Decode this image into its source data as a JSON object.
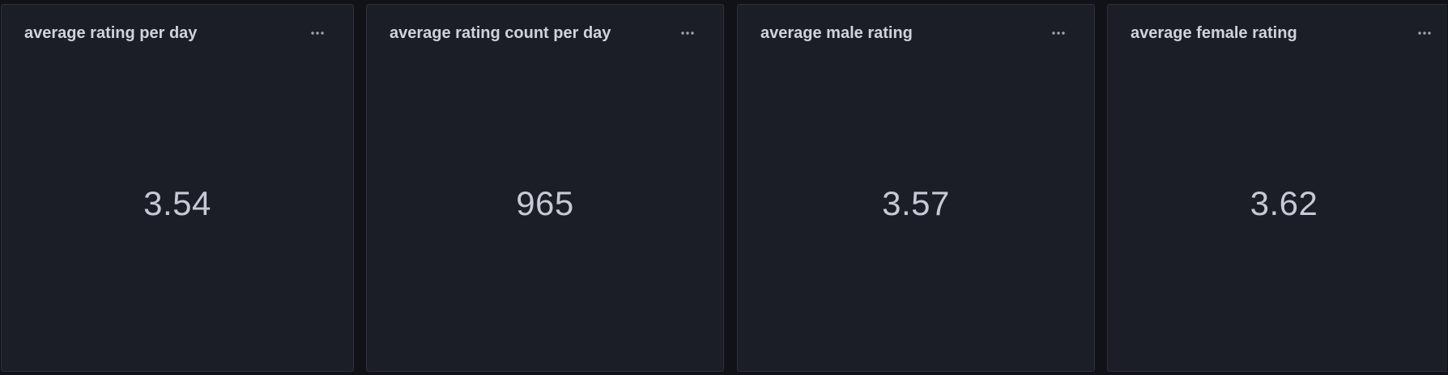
{
  "panels": [
    {
      "title": "average rating per day",
      "value": "3.54",
      "menu_icon": "ellipsis-icon"
    },
    {
      "title": "average rating count per day",
      "value": "965",
      "menu_icon": "ellipsis-icon"
    },
    {
      "title": "average male rating",
      "value": "3.57",
      "menu_icon": "ellipsis-icon"
    },
    {
      "title": "average female rating",
      "value": "3.62",
      "menu_icon": "ellipsis-icon"
    }
  ],
  "colors": {
    "background": "#111217",
    "panel_background": "#1b1e26",
    "panel_border": "#2c303a",
    "title_text": "#d0d3da",
    "value_text": "#c5cad6",
    "menu_icon": "#9da5b4"
  }
}
